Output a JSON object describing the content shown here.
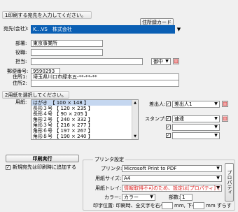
{
  "section1": {
    "title": "1印刷する宛先を入力してください。",
    "address_book_button": "住所録カード",
    "sender_label": "宛先(会社):",
    "sender_value": "K…VS　株式会社",
    "dept_label": "部署:",
    "dept_value": "東京事業所",
    "role_label": "役職:",
    "role_value": "",
    "person_label": "担当:",
    "person_value": "",
    "honorific_value": "御中",
    "postal_label": "郵便番号:",
    "postal_value": "9590293",
    "address1_label": "住所1:",
    "address1_value": "埼玉県川口市緑本五-**-**-**",
    "address2_label": "住所2:",
    "address2_value": ""
  },
  "section2": {
    "title": "2用紙を選択してください。",
    "paper_label": "用紙:",
    "paper_list": [
      "はがき　【 100 × 148 】",
      "長形３号 【 120 × 235 】",
      "長形４号 【  90 × 205 】",
      "角形２号 【 240 × 332 】",
      "角形３号 【 216 × 277 】",
      "角形６号 【 197 × 267 】",
      "角形８号 【 190 × 240 】"
    ],
    "sender_label": "差出人:",
    "sender_value": "差出人1",
    "stamp_label": "スタンプ:",
    "stamp_value": "速達",
    "stamp2_value": "",
    "stamp3_value": ""
  },
  "print": {
    "print_button": "印刷実行",
    "add_new_label": "新規宛先は印刷時に追加する",
    "settings_title": "プリンタ設定",
    "printer_label": "プリンタ:",
    "printer_value": "Microsoft Print to PDF",
    "paper_size_label": "用紙サイズ:",
    "paper_size_value": "A4",
    "tray_label": "用紙トレイ:",
    "tray_value": "情報取得不可のため、設定は[プロパティ]でして下さい",
    "color_label": "カラー:",
    "color_value": "カラー",
    "copies_label": "部数:",
    "copies_value": "1",
    "position_label": "印字位置: 印刷時、全文字を右へ",
    "position_unit1": "mm, 下へ",
    "position_unit2": "mm ずらす",
    "properties_button": "プロパティ"
  }
}
